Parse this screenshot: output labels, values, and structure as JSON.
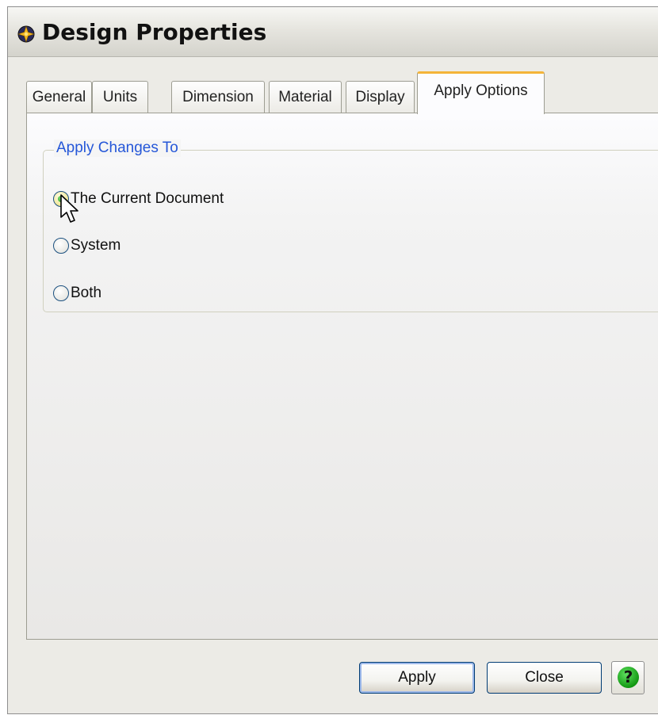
{
  "window": {
    "title": "Design Properties",
    "app_icon": "compass-star-icon"
  },
  "tabs": [
    {
      "label": "General",
      "active": false
    },
    {
      "label": "Units",
      "active": false
    },
    {
      "label": "Dimension",
      "active": false
    },
    {
      "label": "Material",
      "active": false
    },
    {
      "label": "Display",
      "active": false
    },
    {
      "label": "Apply Options",
      "active": true
    }
  ],
  "apply_options": {
    "group_title": "Apply Changes To",
    "options": [
      {
        "label": "The Current Document",
        "checked": true
      },
      {
        "label": "System",
        "checked": false
      },
      {
        "label": "Both",
        "checked": false
      }
    ]
  },
  "buttons": {
    "apply_label": "Apply",
    "close_label": "Close",
    "help_glyph": "?",
    "help_icon": "help-question-icon"
  },
  "colors": {
    "legend_text": "#2557d8",
    "active_tab_accent": "#f4b439",
    "radio_checked_dot": "#21a121",
    "help_icon_green": "#139913",
    "dialog_background": "#ecebe6"
  }
}
